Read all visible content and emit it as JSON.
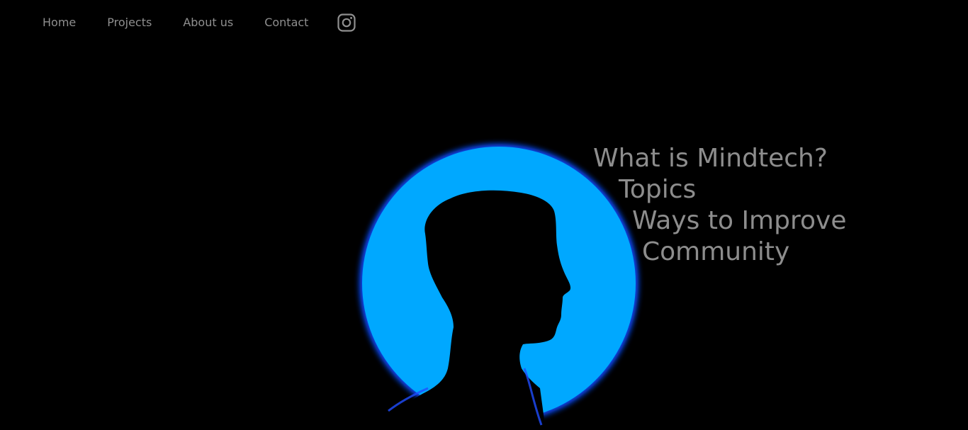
{
  "nav": {
    "items": [
      {
        "label": "Home"
      },
      {
        "label": "Projects"
      },
      {
        "label": "About us"
      },
      {
        "label": "Contact"
      }
    ],
    "social_icon": "instagram-icon"
  },
  "hero": {
    "image_subject": "silhouette of a person in profile in front of a glowing blue circle",
    "links": [
      {
        "label": "What is Mindtech?"
      },
      {
        "label": "Topics"
      },
      {
        "label": "Ways to Improve"
      },
      {
        "label": "Community"
      }
    ]
  },
  "colors": {
    "background": "#000000",
    "nav_text": "#8f8f8f",
    "hero_text": "#8d8d8d",
    "circle_blue": "#00a8ff",
    "glow_blue": "#0a4cff"
  }
}
